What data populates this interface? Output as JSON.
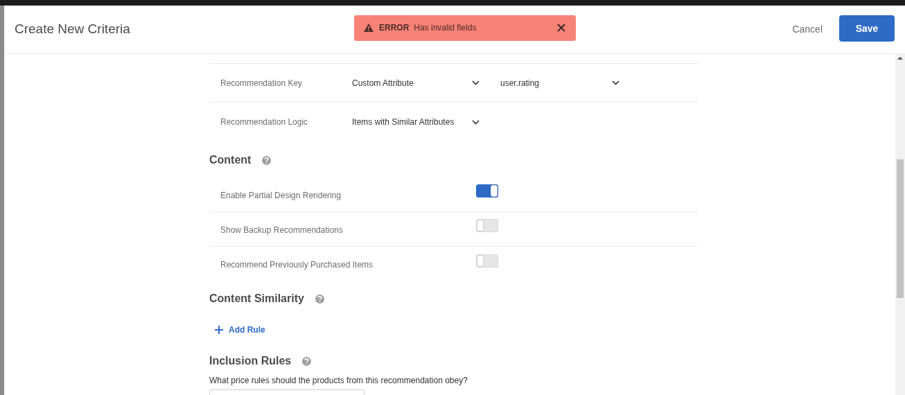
{
  "dialog": {
    "title": "Create New Criteria",
    "cancel": "Cancel",
    "save": "Save"
  },
  "alert": {
    "label": "ERROR",
    "message": "Has invalid fields"
  },
  "settings": [
    {
      "label": "Recommendation Key",
      "selects": [
        "Custom Attribute",
        "user.rating"
      ]
    },
    {
      "label": "Recommendation Logic",
      "selects": [
        "Items with Similar Attributes"
      ]
    }
  ],
  "content": {
    "heading": "Content",
    "toggles": [
      {
        "label": "Enable Partial Design Rendering",
        "on": true
      },
      {
        "label": "Show Backup Recommendations",
        "on": false
      },
      {
        "label": "Recommend Previously Purchased Items",
        "on": false
      }
    ]
  },
  "content_similarity": {
    "heading": "Content Similarity",
    "add_rule": "Add Rule"
  },
  "inclusion_rules": {
    "heading": "Inclusion Rules",
    "question": "What price rules should the products from this recommendation obey?"
  }
}
